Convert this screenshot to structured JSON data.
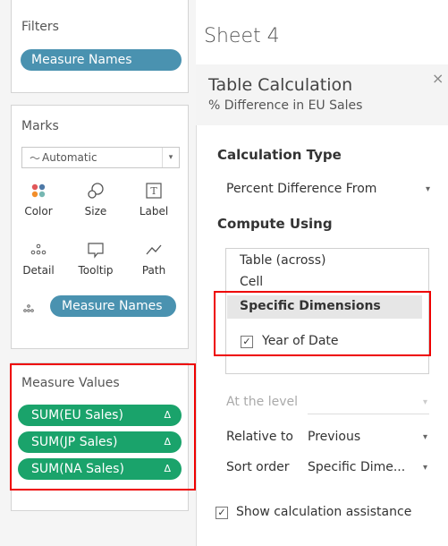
{
  "filters": {
    "title": "Filters",
    "pill": "Measure Names"
  },
  "marks": {
    "title": "Marks",
    "mark_type": "Automatic",
    "buttons": [
      {
        "label": "Color",
        "icon": "color-icon"
      },
      {
        "label": "Size",
        "icon": "size-icon"
      },
      {
        "label": "Label",
        "icon": "label-icon"
      },
      {
        "label": "Detail",
        "icon": "detail-icon"
      },
      {
        "label": "Tooltip",
        "icon": "tooltip-icon"
      },
      {
        "label": "Path",
        "icon": "path-icon"
      }
    ],
    "detail_pill": "Measure Names"
  },
  "measure_values": {
    "title": "Measure Values",
    "pills": [
      "SUM(EU Sales)",
      "SUM(JP Sales)",
      "SUM(NA Sales)"
    ],
    "delta_symbol": "Δ"
  },
  "sheet_title": "Sheet 4",
  "table_calc": {
    "title": "Table Calculation",
    "subtitle": "% Difference in EU Sales",
    "close": "×",
    "calc_type_heading": "Calculation Type",
    "calc_type_value": "Percent Difference From",
    "compute_using_heading": "Compute Using",
    "compute_options": [
      "Table (across)",
      "Cell",
      "Specific Dimensions"
    ],
    "dimension": {
      "label": "Year of Date",
      "checked": true,
      "check_glyph": "✓"
    },
    "at_level_label": "At the level",
    "relative_to_label": "Relative to",
    "relative_to_value": "Previous",
    "sort_order_label": "Sort order",
    "sort_order_value": "Specific Dime...",
    "show_assist_label": "Show calculation assistance",
    "show_assist_checked": true
  },
  "colors": {
    "blue_pill": "#4a92b0",
    "green_pill": "#1aa36b",
    "highlight": "#e00000"
  }
}
